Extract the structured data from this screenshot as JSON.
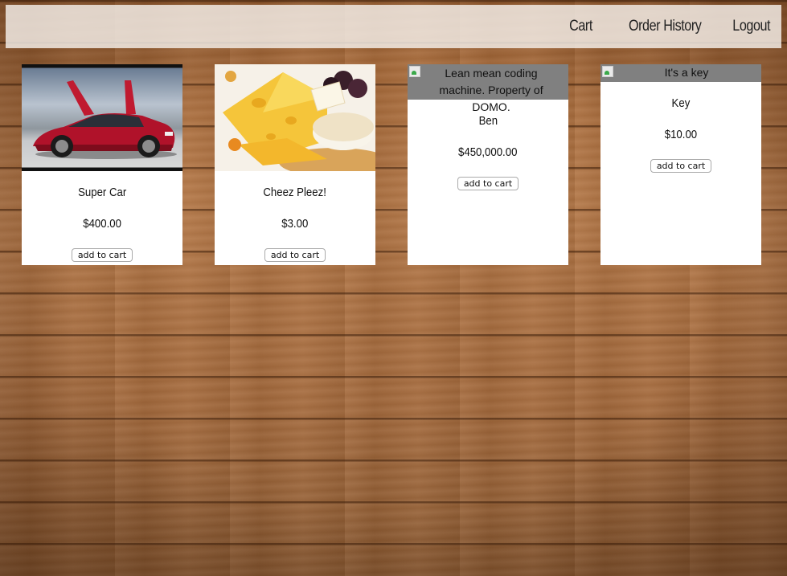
{
  "nav": {
    "cart": "Cart",
    "order_history": "Order History",
    "logout": "Logout"
  },
  "products": [
    {
      "name": "Super Car",
      "price": "$400.00",
      "button": "add to cart",
      "image": "car-photo"
    },
    {
      "name": "Cheez Pleez!",
      "price": "$3.00",
      "button": "add to cart",
      "image": "cheese-photo"
    },
    {
      "name": "Ben",
      "price": "$450,000.00",
      "button": "add to cart",
      "image_alt": "Lean mean coding machine. Property of DOMO."
    },
    {
      "name": "Key",
      "price": "$10.00",
      "button": "add to cart",
      "image_alt": "It's a key"
    }
  ]
}
